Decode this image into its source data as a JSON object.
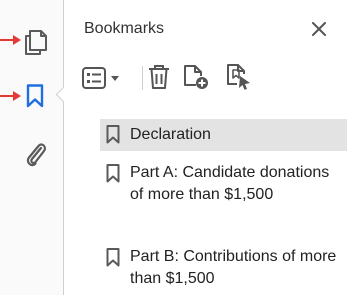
{
  "colors": {
    "annotation_arrow": "#e53935",
    "active_icon": "#1f6fe0",
    "icon": "#5a5a5a",
    "selection": "#e3e3e3"
  },
  "side_rail": {
    "icons": [
      {
        "name": "page-thumbnails-icon",
        "active": false
      },
      {
        "name": "bookmark-icon",
        "active": true
      },
      {
        "name": "attachments-icon",
        "active": false
      }
    ]
  },
  "panel": {
    "title": "Bookmarks",
    "close_icon": "close-icon",
    "toolbar": [
      "options-menu-icon",
      "delete-icon",
      "new-bookmark-icon",
      "add-tagged-bookmark-icon"
    ]
  },
  "bookmarks": [
    {
      "label": "Declaration",
      "selected": true
    },
    {
      "label": "Part A: Candidate donations of more than $1,500",
      "selected": false
    },
    {
      "label": "Part B: Contributions of more than $1,500",
      "selected": false
    }
  ]
}
